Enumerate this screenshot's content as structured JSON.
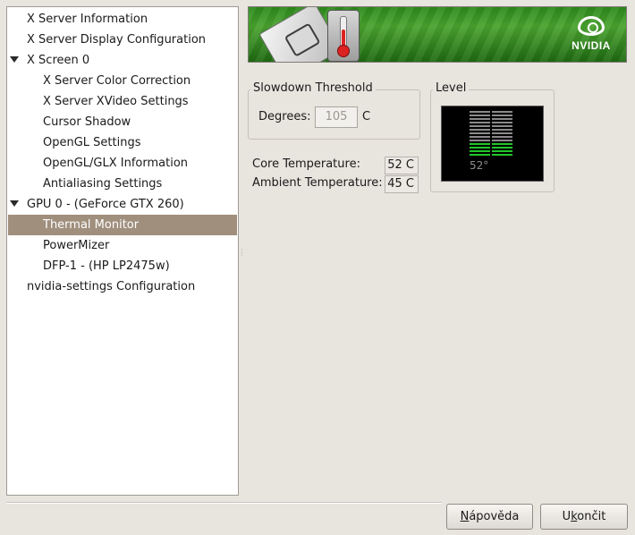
{
  "tree": {
    "items": [
      {
        "label": "X Server Information",
        "indent": 1
      },
      {
        "label": "X Server Display Configuration",
        "indent": 1
      },
      {
        "label": "X Screen 0",
        "indent": 1,
        "expanded": true
      },
      {
        "label": "X Server Color Correction",
        "indent": 2
      },
      {
        "label": "X Server XVideo Settings",
        "indent": 2
      },
      {
        "label": "Cursor Shadow",
        "indent": 2
      },
      {
        "label": "OpenGL Settings",
        "indent": 2
      },
      {
        "label": "OpenGL/GLX Information",
        "indent": 2
      },
      {
        "label": "Antialiasing Settings",
        "indent": 2
      },
      {
        "label": "GPU 0 - (GeForce GTX 260)",
        "indent": 1,
        "expanded": true
      },
      {
        "label": "Thermal Monitor",
        "indent": 2,
        "selected": true
      },
      {
        "label": "PowerMizer",
        "indent": 2
      },
      {
        "label": "DFP-1 - (HP LP2475w)",
        "indent": 2
      },
      {
        "label": "nvidia-settings Configuration",
        "indent": 1
      }
    ]
  },
  "banner": {
    "logo_text": "NVIDIA",
    "icons": [
      "gpu-chip-icon",
      "thermometer-icon",
      "nvidia-logo-icon"
    ]
  },
  "slowdown": {
    "title": "Slowdown Threshold",
    "degrees_label": "Degrees:",
    "degrees_value": "105",
    "unit": "C"
  },
  "temps": {
    "core_label": "Core Temperature:",
    "core_value": "52 C",
    "ambient_label": "Ambient Temperature:",
    "ambient_value": "45 C"
  },
  "level": {
    "title": "Level",
    "readout": "52°",
    "bars_total": 13,
    "bars_lit": 4,
    "lit_color": "#22c52a",
    "unlit_color": "#8a8a8a"
  },
  "buttons": {
    "help_mnemonic": "N",
    "help_rest": "ápověda",
    "quit_pre": "U",
    "quit_mnemonic": "k",
    "quit_rest": "ončit"
  },
  "colors": {
    "selection": "#a08f7d",
    "window_bg": "#e8e4de"
  }
}
